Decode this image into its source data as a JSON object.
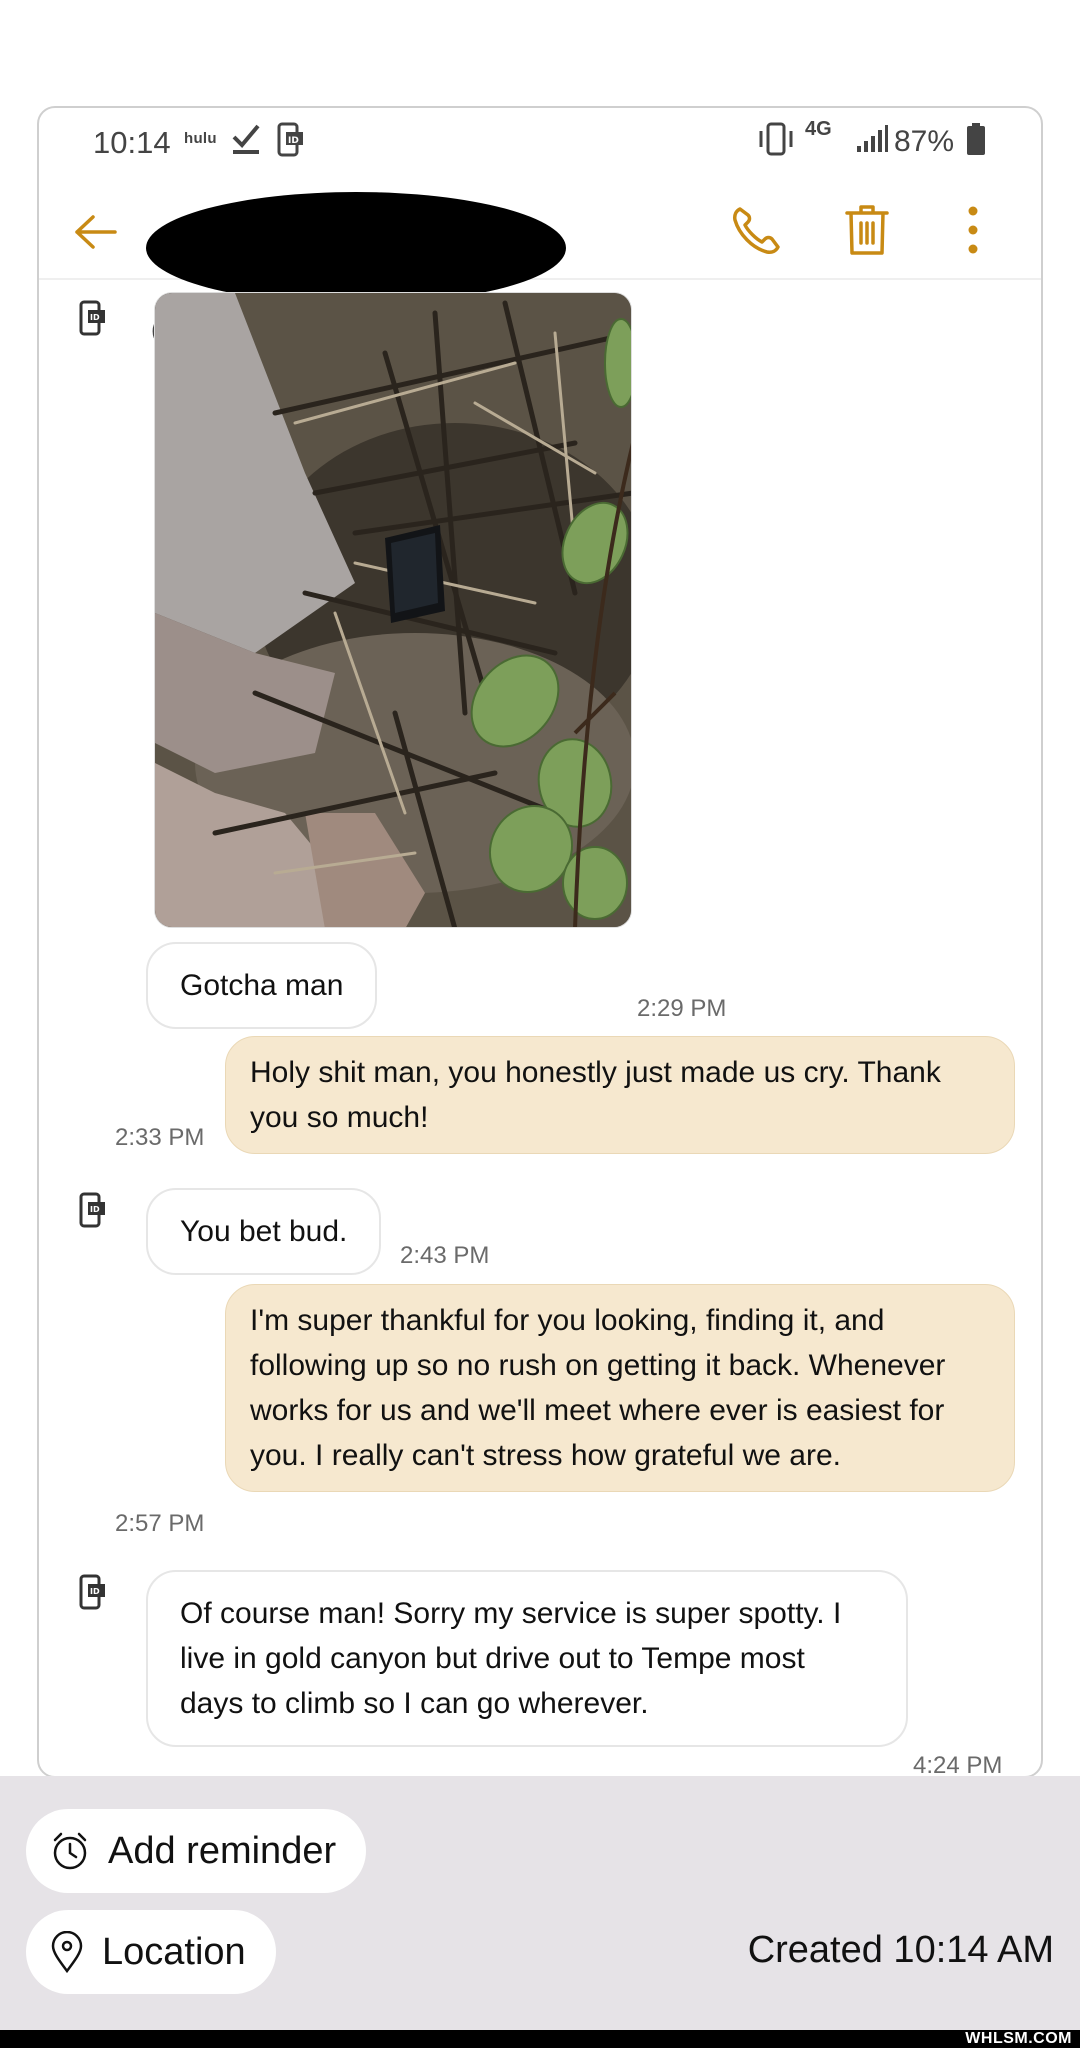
{
  "status_bar": {
    "time": "10:14",
    "hulu": "hulu",
    "network": "4G",
    "battery": "87%"
  },
  "header": {
    "contact_name": "(",
    "back_icon": "arrow-left-icon",
    "call_icon": "phone-icon",
    "delete_icon": "trash-icon",
    "more_icon": "more-vertical-icon",
    "accent_color": "#c88a14"
  },
  "messages": [
    {
      "type": "image",
      "direction": "incoming",
      "alt": "photo of phone among rocks and branches"
    },
    {
      "type": "text",
      "direction": "incoming",
      "text": "Gotcha man",
      "time": "2:29 PM"
    },
    {
      "type": "text",
      "direction": "outgoing",
      "text": "Holy shit man, you honestly just made us cry. Thank you so much!",
      "time": "2:33 PM"
    },
    {
      "type": "text",
      "direction": "incoming",
      "text": "You bet bud.",
      "time": "2:43 PM"
    },
    {
      "type": "text",
      "direction": "outgoing",
      "text": "I'm super thankful for you looking, finding it, and following up so no rush on getting it back. Whenever works for us and we'll meet where ever is easiest for you. I really can't stress how grateful we are.",
      "time": "2:57 PM"
    },
    {
      "type": "text",
      "direction": "incoming",
      "text": "Of course man! Sorry my service is super spotty. I live in gold canyon but drive out to Tempe most days to climb so I can go wherever.",
      "time": "4:24 PM"
    }
  ],
  "reminder_panel": {
    "add_reminder": "Add reminder",
    "location": "Location",
    "created": "Created 10:14 AM"
  },
  "watermark": "WHLSM.COM",
  "colors": {
    "outgoing_bubble": "#f6e8cf",
    "incoming_bubble": "#ffffff",
    "panel": "#e6e3e7"
  }
}
